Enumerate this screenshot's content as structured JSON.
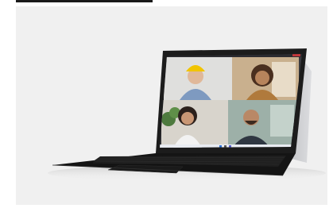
{
  "image": {
    "subject": "tablet-with-keyboard-video-call",
    "background_color": "#f0f0f0",
    "device_color": "#1c1c1c",
    "kickstand_color": "#c9cacc",
    "call_participants": 4
  }
}
